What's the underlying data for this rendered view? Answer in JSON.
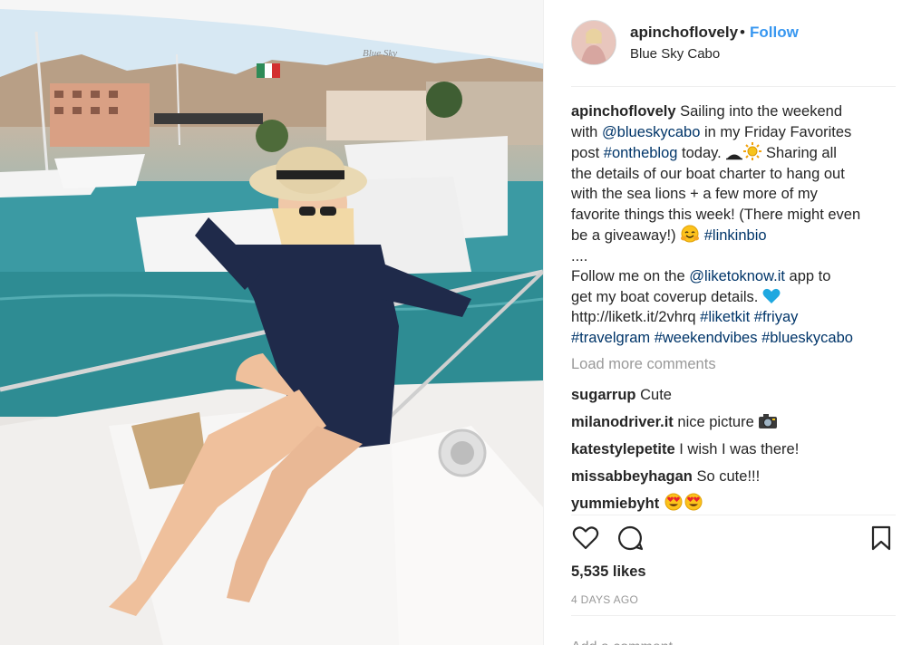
{
  "post": {
    "image_label": "Blue Sky",
    "image_description": "woman in hat and sunglasses sitting on the bow of a yacht in a marina"
  },
  "header": {
    "username": "apinchoflovely",
    "separator": "•",
    "follow_label": "Follow",
    "location": "Blue Sky Cabo"
  },
  "caption": {
    "username": "apinchoflovely",
    "l1": "Sailing into the weekend",
    "l2_pre": "with ",
    "l2_link": "@blueskycabo",
    "l2_post": " in my Friday Favorites",
    "l3_pre": "post ",
    "l3_link": "#ontheblog",
    "l3_post": " today. ",
    "l3_after_emoji": " Sharing all",
    "l4": "the details of our boat charter to hang out",
    "l5": "with the sea lions + a few more of my",
    "l6": "favorite things this week! (There might even",
    "l7_pre": "be a giveaway!) ",
    "l7_link": "#linkinbio",
    "l8": "....",
    "l9_pre": "Follow me on the ",
    "l9_link": "@liketoknow.it",
    "l9_post": " app to",
    "l10": "get my boat coverup details. ",
    "l11_pre": "http://liketk.it/2vhrq ",
    "l11_link1": "#liketkit",
    "l11_sp": " ",
    "l11_link2": "#friyay",
    "l12_link1": "#travelgram",
    "l12_link2": "#weekendvibes",
    "l12_link3": "#blueskycabo"
  },
  "load_more_label": "Load more comments",
  "comments": [
    {
      "user": "sugarrup",
      "text": "Cute"
    },
    {
      "user": "milanodriver.it",
      "text": "nice picture "
    },
    {
      "user": "katestylepetite",
      "text": "I wish I was there!"
    },
    {
      "user": "missabbeyhagan",
      "text": "So cute!!!"
    },
    {
      "user": "yummiebyht",
      "text": ""
    }
  ],
  "actions": {
    "like_icon": "heart-outline-icon",
    "comment_icon": "comment-bubble-icon",
    "save_icon": "bookmark-icon"
  },
  "likes_label": "5,535 likes",
  "time_ago": "4 DAYS AGO",
  "add_comment_placeholder": "Add a comment…",
  "colors": {
    "link": "#003569",
    "follow": "#3897f0",
    "muted": "#999999",
    "text": "#262626"
  }
}
